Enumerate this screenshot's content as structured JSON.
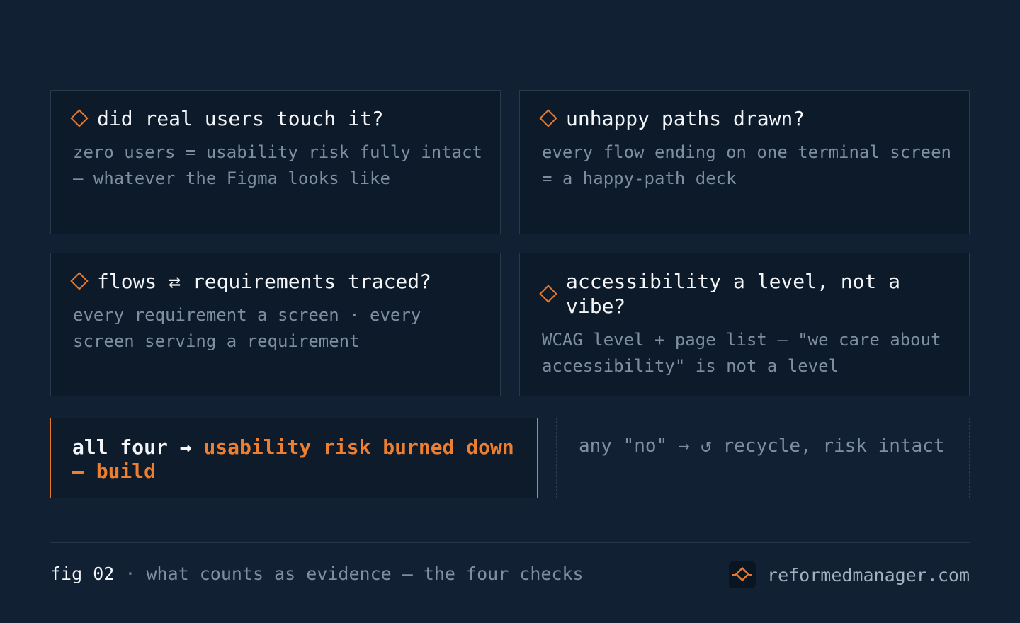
{
  "checks": [
    {
      "title": "did real users touch it?",
      "body": "zero users = usability risk fully intact — whatever the Figma looks like"
    },
    {
      "title": "unhappy paths drawn?",
      "body": "every flow ending on one terminal screen = a happy-path deck"
    },
    {
      "title": "flows ⇄ requirements traced?",
      "body": "every requirement a screen · every screen serving a requirement"
    },
    {
      "title": "accessibility a level, not a vibe?",
      "body": "WCAG level + page list — \"we care about accessibility\" is not a level"
    }
  ],
  "outcome_pass": {
    "lead": "all four →",
    "highlight": "usability risk burned down — build"
  },
  "outcome_fail": {
    "text": "any \"no\" → ↺ recycle, risk intact"
  },
  "footer": {
    "fig_label": "fig 02",
    "separator": "·",
    "caption": "what counts as evidence — the four checks",
    "brand": "reformedmanager.com"
  },
  "colors": {
    "background": "#112032",
    "card": "#0c1a2a",
    "accent": "#e8782a",
    "text": "#f3f5f8",
    "muted": "#7f8fa2"
  },
  "icons": {
    "check_marker": "diamond-outline-icon",
    "brand_logo": "diamond-logo-icon"
  }
}
